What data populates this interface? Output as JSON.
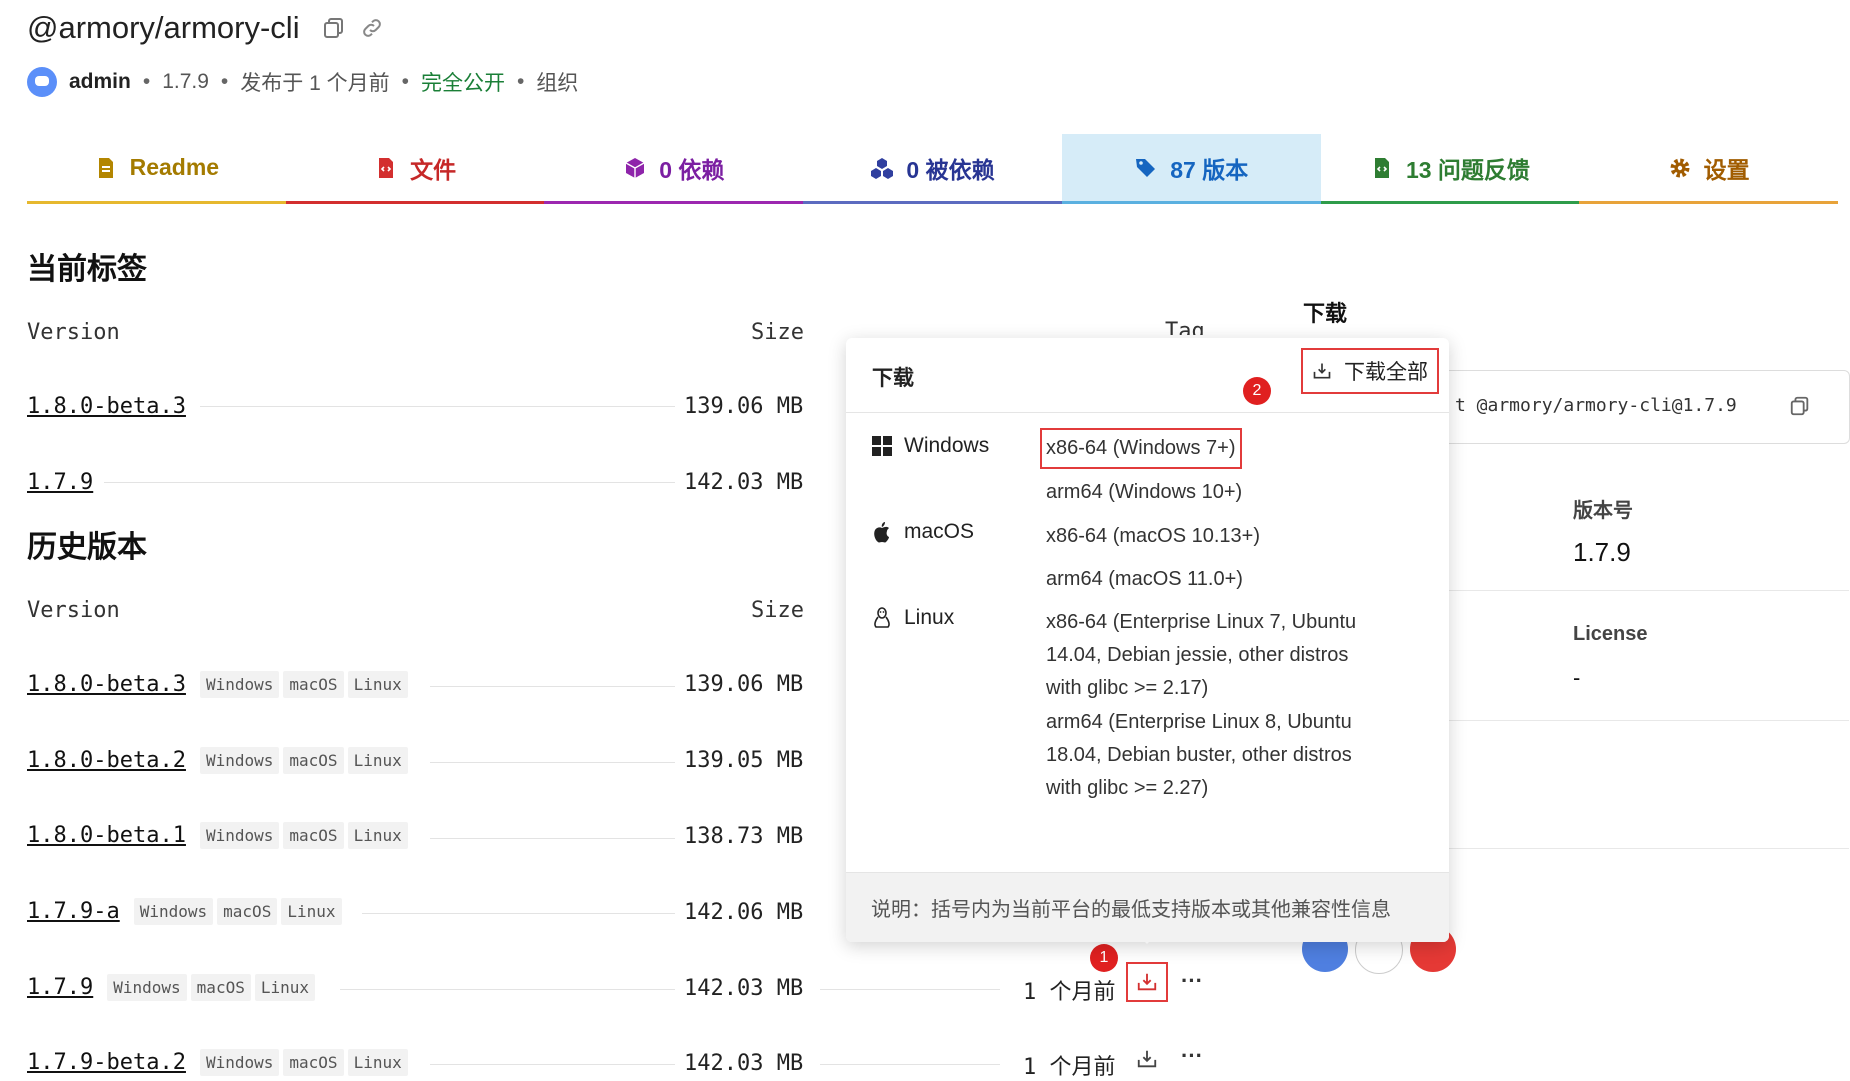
{
  "package": {
    "name": "@armory/armory-cli",
    "user": "admin",
    "version": "1.7.9",
    "published": "发布于 1 个月前",
    "visibility": "完全公开",
    "scope": "组织"
  },
  "tabs": [
    {
      "label": "Readme",
      "color": "#d4a017",
      "icon": "document-icon"
    },
    {
      "label": "文件",
      "color": "#d32f2f",
      "icon": "file-code-icon"
    },
    {
      "label": "0 依赖",
      "color": "#8e24aa",
      "icon": "cube-icon"
    },
    {
      "label": "0 被依赖",
      "color": "#3949ab",
      "icon": "cubes-icon"
    },
    {
      "label": "87 版本",
      "color": "#1565c0",
      "icon": "tags-icon",
      "active": true
    },
    {
      "label": "13 问题反馈",
      "color": "#2e7d32",
      "icon": "file-code-icon"
    },
    {
      "label": "设置",
      "color": "#c77800",
      "icon": "gear-icon"
    }
  ],
  "current": {
    "title": "当前标签",
    "col_version": "Version",
    "col_size": "Size",
    "col_tag": "Tag",
    "rows": [
      {
        "version": "1.8.0-beta.3",
        "size": "139.06 MB"
      },
      {
        "version": "1.7.9",
        "size": "142.03 MB"
      }
    ]
  },
  "history": {
    "title": "历史版本",
    "col_version": "Version",
    "col_size": "Size",
    "platforms": [
      "Windows",
      "macOS",
      "Linux"
    ],
    "rows": [
      {
        "version": "1.8.0-beta.3",
        "size": "139.06 MB"
      },
      {
        "version": "1.8.0-beta.2",
        "size": "139.05 MB"
      },
      {
        "version": "1.8.0-beta.1",
        "size": "138.73 MB"
      },
      {
        "version": "1.7.9-a",
        "size": "142.06 MB"
      },
      {
        "version": "1.7.9",
        "size": "142.03 MB",
        "time": "1 个月前"
      },
      {
        "version": "1.7.9-beta.2",
        "size": "142.03 MB",
        "time": "1 个月前"
      }
    ]
  },
  "side": {
    "download_heading": "下载",
    "install_cmd": "t @armory/armory-cli@1.7.9",
    "version_label": "版本号",
    "version_value": "1.7.9",
    "license_label": "License",
    "license_value": "-"
  },
  "popup": {
    "title": "下载",
    "download_all": "下载全部",
    "platforms": [
      {
        "name": "Windows",
        "options": [
          "x86-64 (Windows 7+)",
          "arm64 (Windows 10+)"
        ]
      },
      {
        "name": "macOS",
        "options": [
          "x86-64 (macOS 10.13+)",
          "arm64 (macOS 11.0+)"
        ]
      },
      {
        "name": "Linux",
        "options": [
          "x86-64 (Enterprise Linux 7, Ubuntu 14.04, Debian jessie, other distros with glibc >= 2.17)",
          "arm64 (Enterprise Linux 8, Ubuntu 18.04, Debian buster, other distros with glibc >= 2.27)"
        ]
      }
    ],
    "note": "说明：括号内为当前平台的最低支持版本或其他兼容性信息"
  },
  "badges": [
    "1",
    "2"
  ],
  "more": "···"
}
